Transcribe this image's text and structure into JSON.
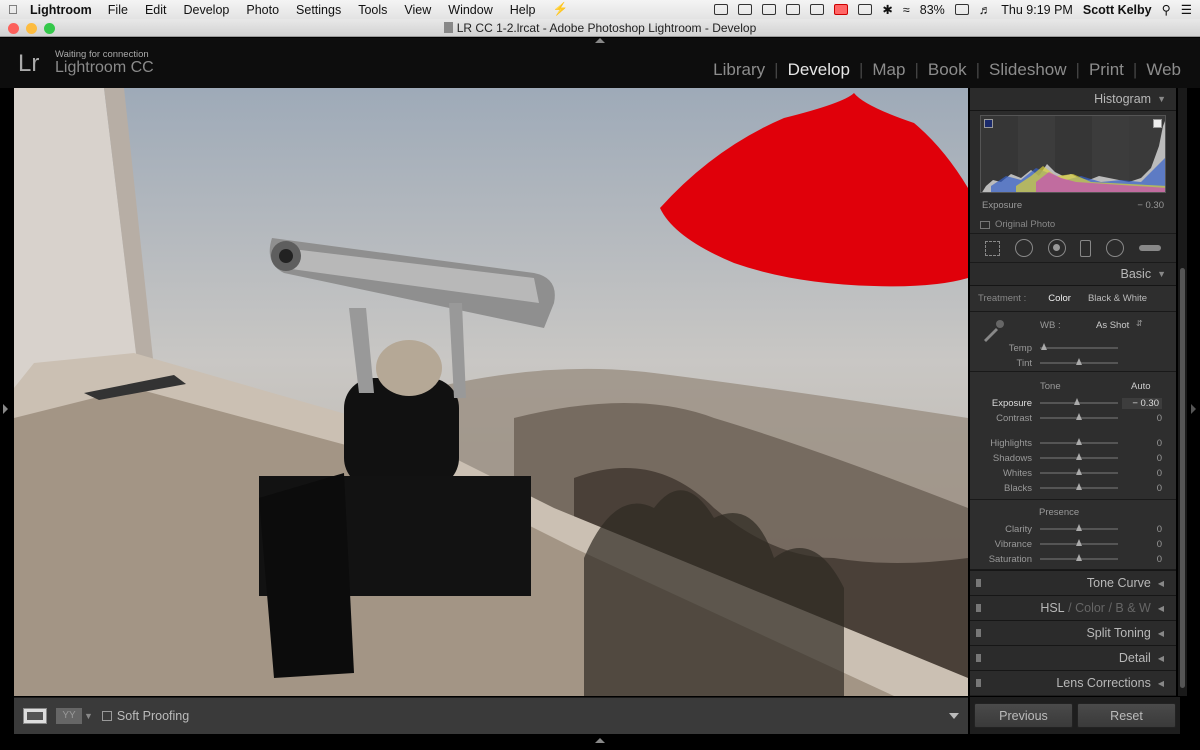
{
  "menubar": {
    "app": "Lightroom",
    "items": [
      "File",
      "Edit",
      "Develop",
      "Photo",
      "Settings",
      "Tools",
      "View",
      "Window",
      "Help"
    ],
    "battery": "83%",
    "clock": "Thu 9:19 PM",
    "user": "Scott Kelby"
  },
  "window": {
    "title": "LR CC 1-2.lrcat - Adobe Photoshop Lightroom - Develop"
  },
  "identity": {
    "logo": "Lr",
    "status": "Waiting for connection",
    "product": "Lightroom CC"
  },
  "modules": [
    "Library",
    "Develop",
    "Map",
    "Book",
    "Slideshow",
    "Print",
    "Web"
  ],
  "active_module": "Develop",
  "toolbar": {
    "yy": "YY",
    "soft_proofing": "Soft Proofing"
  },
  "histogram": {
    "title": "Histogram",
    "readout_label": "Exposure",
    "readout_value": "− 0.30",
    "original_photo": "Original Photo"
  },
  "basic": {
    "title": "Basic",
    "treatment_label": "Treatment :",
    "treatment_color": "Color",
    "treatment_bw": "Black & White",
    "wb_label": "WB :",
    "wb_value": "As Shot",
    "wb_sliders": [
      {
        "name": "Temp",
        "value": "",
        "pos": 0.05
      },
      {
        "name": "Tint",
        "value": "",
        "pos": 0.5
      }
    ],
    "tone_label": "Tone",
    "auto": "Auto",
    "tone_sliders": [
      {
        "name": "Exposure",
        "value": "− 0.30",
        "pos": 0.47
      },
      {
        "name": "Contrast",
        "value": "0",
        "pos": 0.5
      }
    ],
    "tone_sliders2": [
      {
        "name": "Highlights",
        "value": "0",
        "pos": 0.5
      },
      {
        "name": "Shadows",
        "value": "0",
        "pos": 0.5
      },
      {
        "name": "Whites",
        "value": "0",
        "pos": 0.5
      },
      {
        "name": "Blacks",
        "value": "0",
        "pos": 0.5
      }
    ],
    "presence_label": "Presence",
    "presence_sliders": [
      {
        "name": "Clarity",
        "value": "0",
        "pos": 0.5
      },
      {
        "name": "Vibrance",
        "value": "0",
        "pos": 0.5
      },
      {
        "name": "Saturation",
        "value": "0",
        "pos": 0.5
      }
    ]
  },
  "panels": {
    "tone_curve": "Tone Curve",
    "hsl": "HSL",
    "color": "Color",
    "bw": "B & W",
    "slash": "/",
    "split_toning": "Split Toning",
    "detail": "Detail",
    "lens": "Lens Corrections"
  },
  "buttons": {
    "previous": "Previous",
    "reset": "Reset"
  },
  "colors": {
    "accent_red": "#e0000a",
    "panel": "#2e2e2e"
  }
}
